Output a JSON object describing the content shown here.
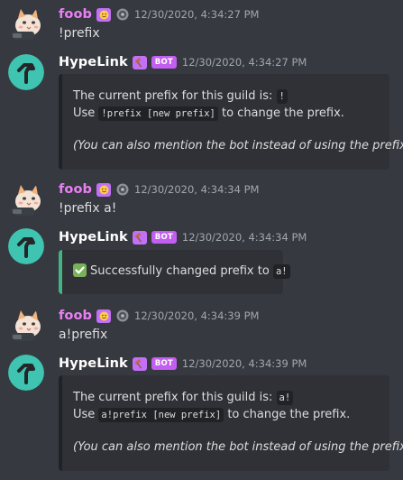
{
  "messages": [
    {
      "author": "foob",
      "author_color": "#ea7ff5",
      "timestamp": "12/30/2020, 4:34:27 PM",
      "content": "!prefix"
    },
    {
      "author": "HypeLink",
      "author_color": "#ffffff",
      "bot_badge": "BOT",
      "timestamp": "12/30/2020, 4:34:27 PM",
      "embed": {
        "line1_text": "The current prefix for this guild is: ",
        "line1_code": "!",
        "line2_prefix": "Use ",
        "line2_code": "!prefix [new prefix]",
        "line2_suffix": " to change the prefix.",
        "note": "(You can also mention the bot instead of using the prefix)"
      }
    },
    {
      "author": "foob",
      "author_color": "#ea7ff5",
      "timestamp": "12/30/2020, 4:34:34 PM",
      "content": "!prefix a!"
    },
    {
      "author": "HypeLink",
      "author_color": "#ffffff",
      "bot_badge": "BOT",
      "timestamp": "12/30/2020, 4:34:34 PM",
      "embed": {
        "success_text": "Successfully changed prefix to ",
        "success_code": "a!"
      }
    },
    {
      "author": "foob",
      "author_color": "#ea7ff5",
      "timestamp": "12/30/2020, 4:34:39 PM",
      "content": "a!prefix"
    },
    {
      "author": "HypeLink",
      "author_color": "#ffffff",
      "bot_badge": "BOT",
      "timestamp": "12/30/2020, 4:34:39 PM",
      "embed": {
        "line1_text": "The current prefix for this guild is: ",
        "line1_code": "a!",
        "line2_prefix": "Use ",
        "line2_code": "a!prefix [new prefix]",
        "line2_suffix": " to change the prefix.",
        "note": "(You can also mention the bot instead of using the prefix)"
      }
    }
  ],
  "icons": {
    "foob_avatar": "cat-avatar-icon",
    "bot_avatar": "hypelink-avatar-icon",
    "user_badge": "emoji-badge-icon",
    "user_status": "disc-icon",
    "bot_role": "hammer-icon",
    "success": "check-mark-icon"
  },
  "colors": {
    "background": "#36393f",
    "embed_background": "#2f3136",
    "success_border": "#43b581",
    "bot_badge": "#c25ef0",
    "bot_avatar": "#3ec4b0"
  }
}
